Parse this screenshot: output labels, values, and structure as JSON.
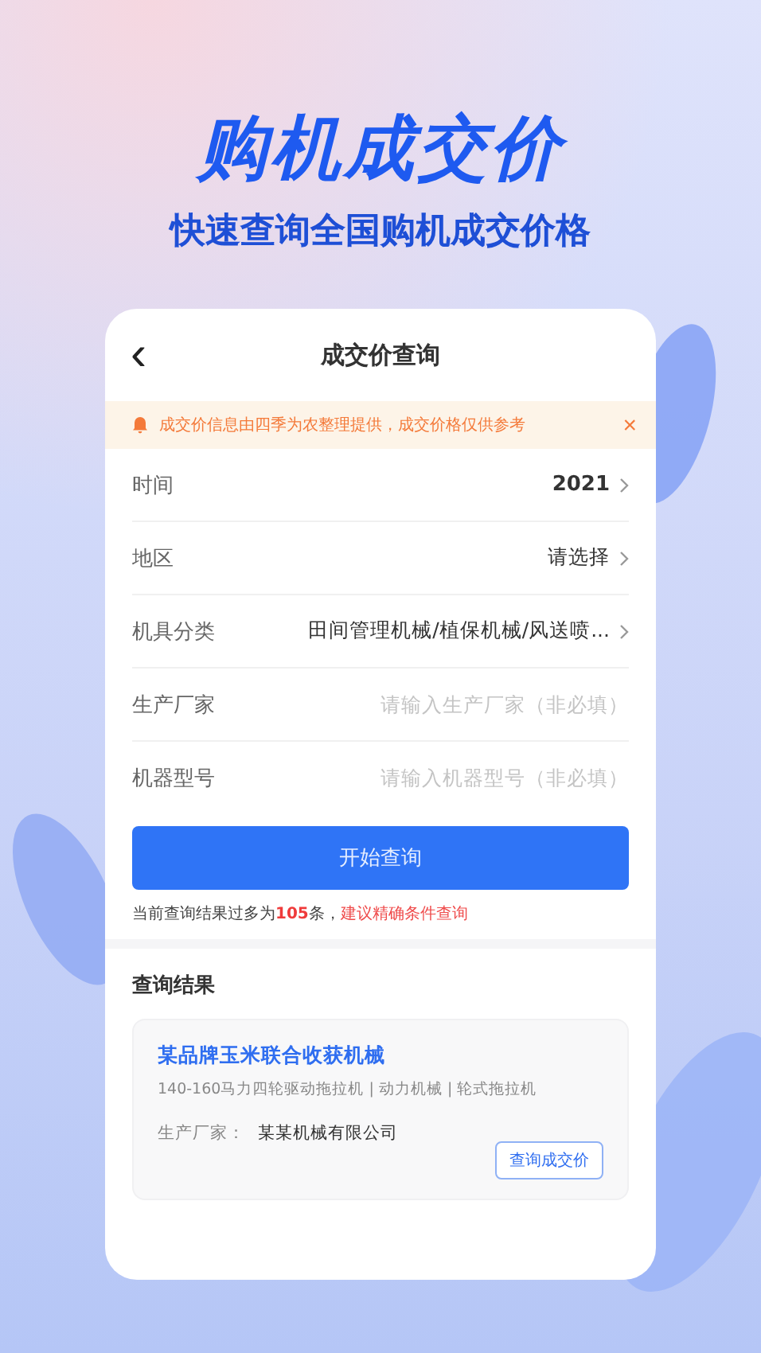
{
  "headline": "购机成交价",
  "subtitle": "快速查询全国购机成交价格",
  "screen": {
    "back_icon": "‹",
    "title": "成交价查询",
    "notice": {
      "text": "成交价信息由四季为农整理提供，成交价格仅供参考",
      "close": "×"
    },
    "fields": [
      {
        "kind": "select",
        "label": "时间",
        "value": "2021",
        "bold": true
      },
      {
        "kind": "select",
        "label": "地区",
        "value": "请选择",
        "bold": false
      },
      {
        "kind": "select",
        "label": "机具分类",
        "value": "田间管理机械/植保机械/风送喷...",
        "bold": false
      },
      {
        "kind": "input",
        "label": "生产厂家",
        "placeholder": "请输入生产厂家（非必填）"
      },
      {
        "kind": "input",
        "label": "机器型号",
        "placeholder": "请输入机器型号（非必填）"
      }
    ],
    "submit": "开始查询",
    "hint": {
      "before": "当前查询结果过多为",
      "count": "105",
      "after": "条，",
      "link": "建议精确条件查询"
    },
    "results_title": "查询结果",
    "results": [
      {
        "name": "某品牌玉米联合收获机械",
        "tags": "140-160马力四轮驱动拖拉机 | 动力机械 | 轮式拖拉机",
        "maker_label": "生产厂家：",
        "maker": "某某机械有限公司",
        "action": "查询成交价"
      }
    ]
  }
}
